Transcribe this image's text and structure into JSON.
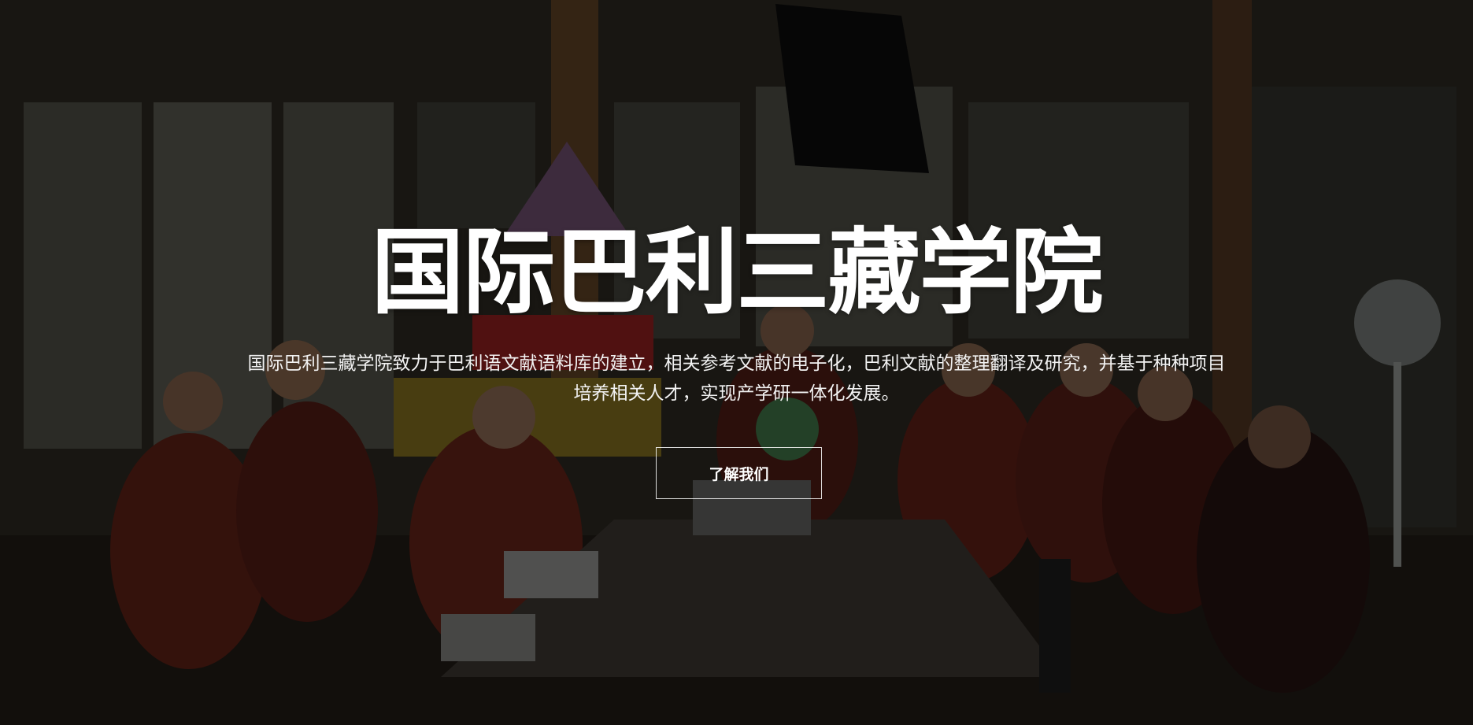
{
  "hero": {
    "title": "国际巴利三藏学院",
    "description": "国际巴利三藏学院致力于巴利语文献语料库的建立，相关参考文献的电子化，巴利文献的整理翻译及研究，并基于种种项目培养相关人才，实现产学研一体化发展。",
    "cta_label": "了解我们",
    "background_image": "group-of-monks-in-classroom"
  },
  "colors": {
    "text": "#ffffff",
    "overlay": "#000000",
    "robe": "#6b2418"
  }
}
